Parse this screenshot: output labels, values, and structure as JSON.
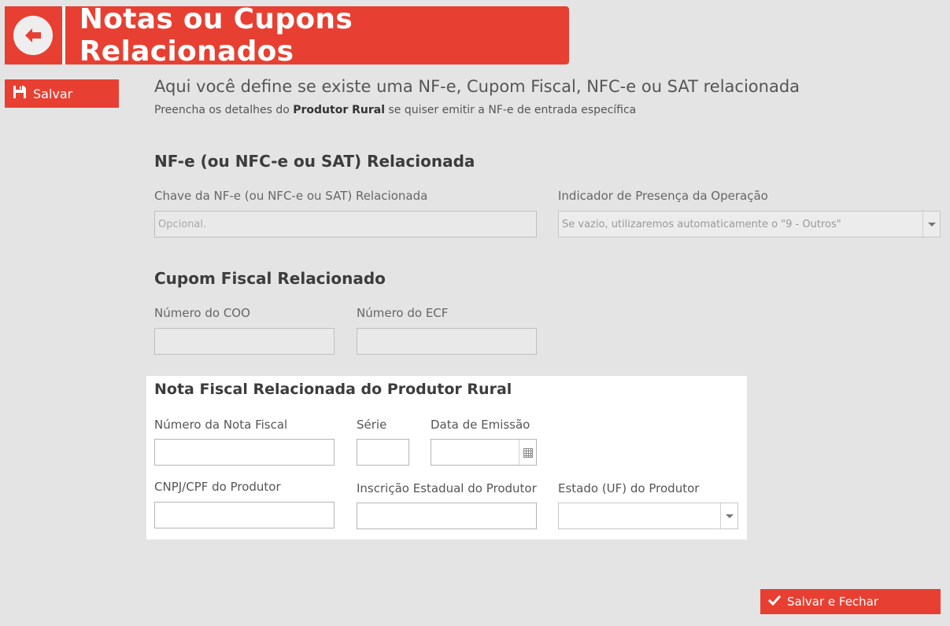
{
  "header": {
    "title": "Notas ou Cupons Relacionados"
  },
  "toolbar": {
    "save_label": "Salvar"
  },
  "intro": {
    "title": "Aqui você define se existe uma NF-e, Cupom Fiscal, NFC-e ou SAT relacionada",
    "sub_prefix": "Preencha os detalhes do ",
    "sub_bold": "Produtor Rural",
    "sub_suffix": " se quiser emitir a NF-e de entrada específica"
  },
  "nfe_section": {
    "title": "NF-e (ou NFC-e ou SAT) Relacionada",
    "chave_label": "Chave da NF-e (ou NFC-e ou SAT) Relacionada",
    "chave_placeholder": "Opcional.",
    "chave_value": "",
    "indicador_label": "Indicador de Presença da Operação",
    "indicador_selected": "Se vazio, utilizaremos automaticamente o \"9 - Outros\""
  },
  "cupom_section": {
    "title": "Cupom Fiscal Relacionado",
    "coo_label": "Número do COO",
    "coo_value": "",
    "ecf_label": "Número do ECF",
    "ecf_value": ""
  },
  "rural_section": {
    "title": "Nota Fiscal Relacionada do Produtor Rural",
    "numero_label": "Número da Nota Fiscal",
    "numero_value": "",
    "serie_label": "Série",
    "serie_value": "",
    "data_label": "Data de Emissão",
    "data_value": "",
    "cnpj_label": "CNPJ/CPF do Produtor",
    "cnpj_value": "",
    "ie_label": "Inscrição Estadual do Produtor",
    "ie_value": "",
    "uf_label": "Estado (UF) do Produtor",
    "uf_selected": ""
  },
  "footer": {
    "save_close_label": "Salvar e Fechar"
  },
  "colors": {
    "accent": "#e74032",
    "background": "#e4e4e4",
    "panel": "#ffffff"
  },
  "icons": {
    "back": "arrow-left-circle-icon",
    "save": "floppy-disk-icon",
    "calendar": "calendar-icon",
    "dropdown": "chevron-down-icon",
    "check": "check-icon"
  }
}
